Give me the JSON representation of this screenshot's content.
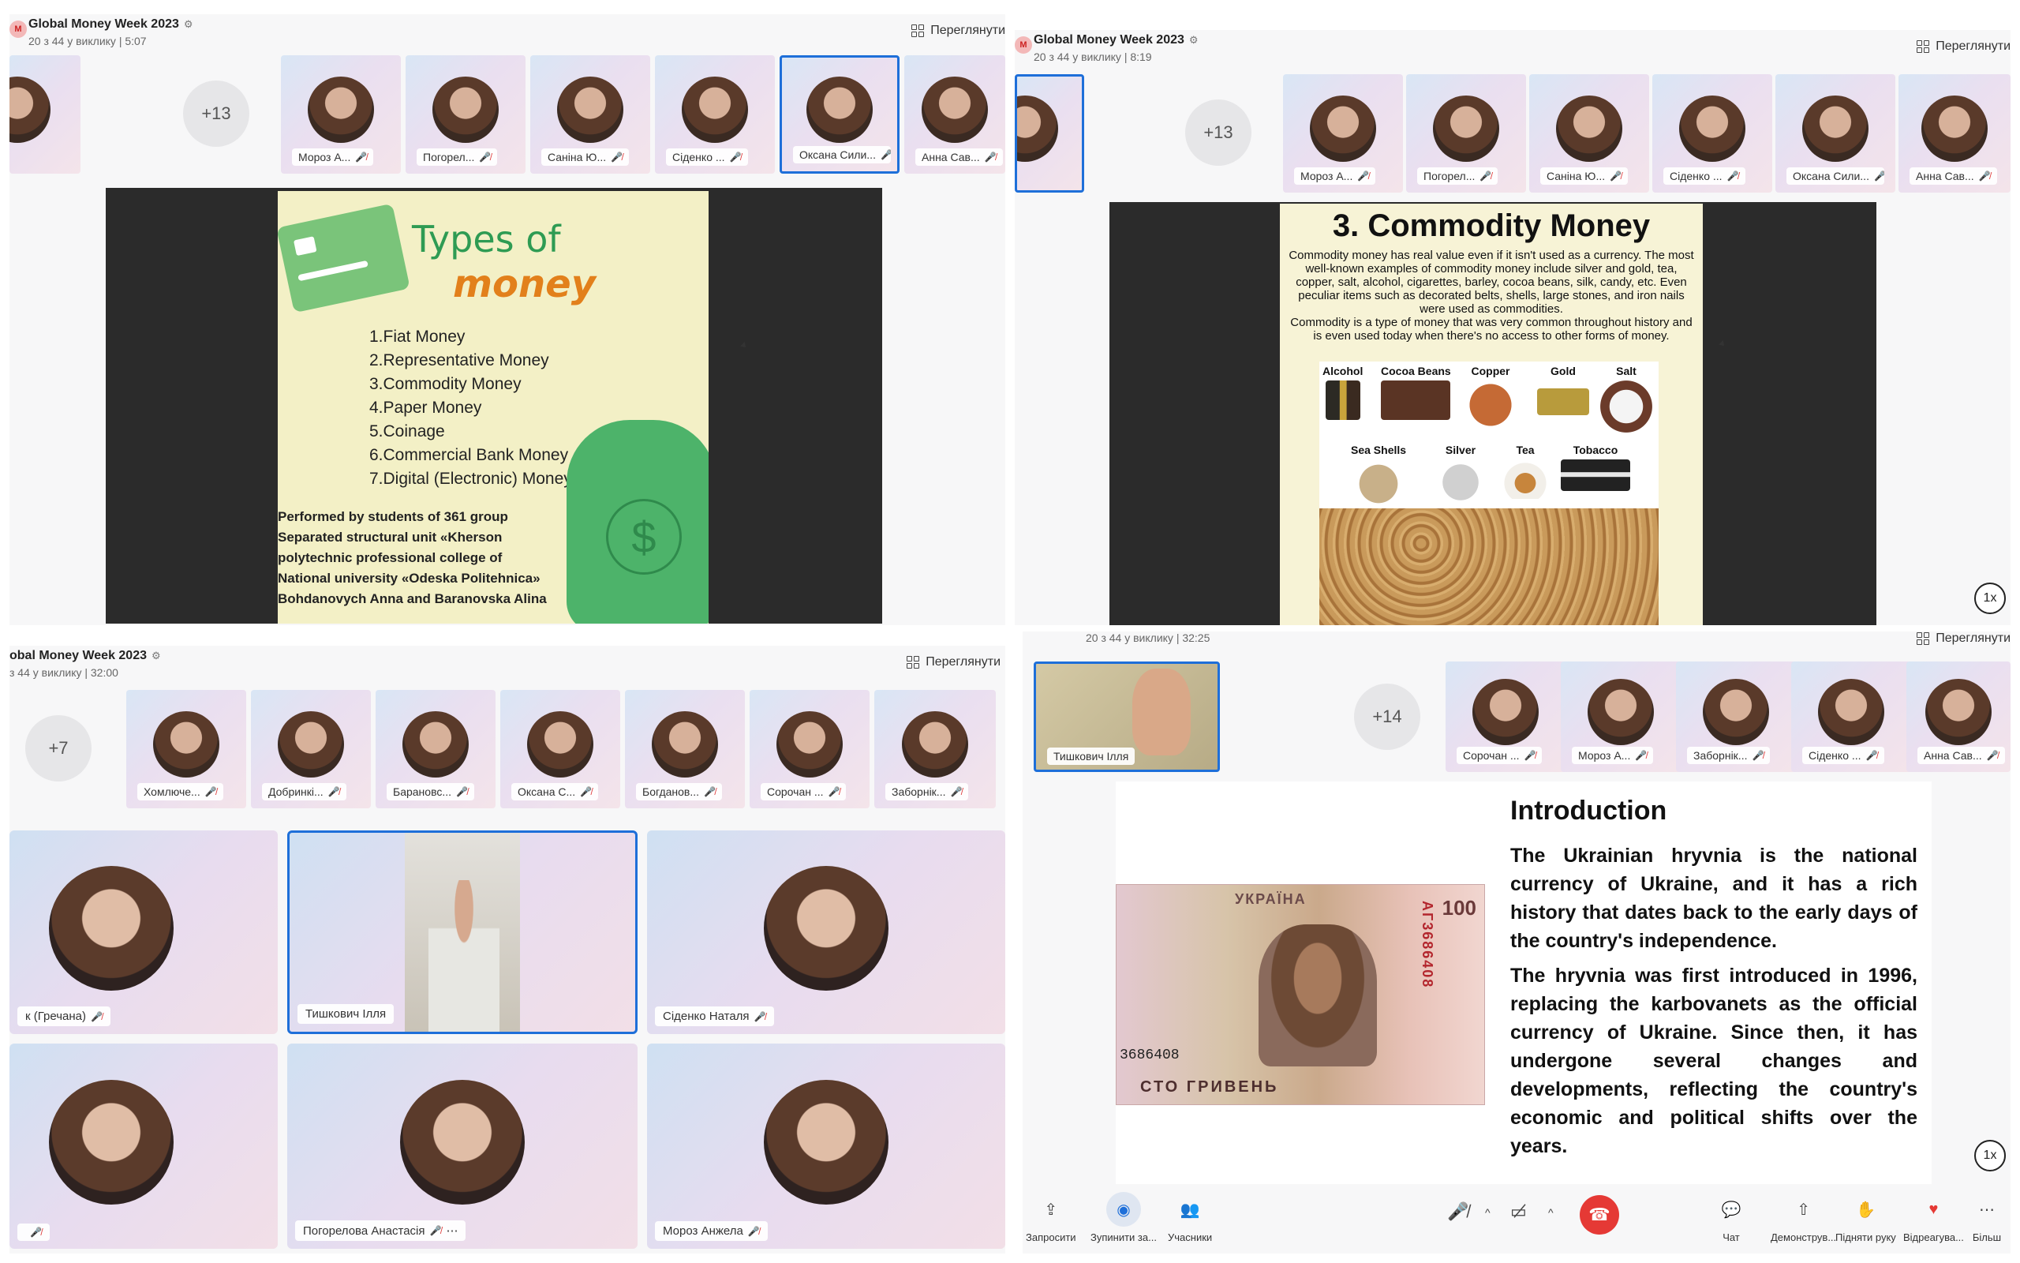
{
  "q1": {
    "title": "Global Money Week 2023",
    "subtitle": "20 з 44 у виклику | 5:07",
    "view_label": "Переглянути",
    "more_count": "+13",
    "participants": [
      "Мороз А...",
      "Погорел...",
      "Саніна Ю...",
      "Сіденко ...",
      "Оксана Сили...",
      "Анна Сав..."
    ],
    "selected_index": 4,
    "slide": {
      "title_word1": "Types of",
      "title_word2": "money",
      "list": [
        "1.Fiat Money",
        "2.Representative Money",
        "3.Commodity Money",
        "4.Paper Money",
        "5.Coinage",
        "6.Commercial Bank Money",
        "7.Digital (Electronic) Money"
      ],
      "credits": [
        "Performed by students of 361 group",
        "Separated structural unit «Kherson",
        "polytechnic professional college of",
        " National  university «Odeska Politehnica»",
        "Bohdanovych Anna and Baranovska Alina"
      ]
    }
  },
  "q2": {
    "title": "Global Money Week 2023",
    "subtitle": "20 з 44 у виклику | 8:19",
    "view_label": "Переглянути",
    "more_count": "+13",
    "participants": [
      "Мороз А...",
      "Погорел...",
      "Саніна Ю...",
      "Сіденко ...",
      "Оксана Сили...",
      "Анна Сав..."
    ],
    "speed": "1x",
    "slide": {
      "heading": "3. Commodity Money",
      "para1": "Commodity money has real value even if it isn't used as a currency. The most well-known examples of commodity money include silver and gold, tea, copper, salt, alcohol, cigarettes, barley, cocoa beans, silk, candy, etc. Even peculiar items such as decorated belts, shells, large stones, and iron nails were used as commodities.",
      "para2": "Commodity is a type of money that was very common throughout history and is even used today when there's no access to other forms of money.",
      "row1": [
        "Alcohol",
        "Cocoa Beans",
        "Copper",
        "Gold",
        "Salt"
      ],
      "row2": [
        "Sea Shells",
        "Silver",
        "Tea",
        "Tobacco"
      ]
    }
  },
  "q3": {
    "title": "obal Money Week 2023",
    "subtitle": "з 44 у виклику | 32:00",
    "view_label": "Переглянути",
    "more_count": "+7",
    "participants": [
      "Хомлюче...",
      "Добринкі...",
      "Барановс...",
      "Оксана С...",
      "Богданов...",
      "Сорочан ...",
      "Заборнік..."
    ],
    "tiles": [
      "к (Гречана)",
      "Тишкович Ілля",
      "Сіденко Наталя",
      "",
      "Погорелова Анастасія",
      "Мороз Анжела"
    ]
  },
  "q4": {
    "subtitle": "20 з 44 у виклику | 32:25",
    "view_label": "Переглянути",
    "speaker_name": "Тишкович Ілля",
    "more_count": "+14",
    "participants": [
      "Сорочан ...",
      "Мороз А...",
      "Заборнік...",
      "Сіденко ...",
      "Анна Сав..."
    ],
    "speed": "1x",
    "slide": {
      "heading": "Introduction",
      "para1": "The Ukrainian hryvnia is the national currency of Ukraine, and it has a rich history that dates back to the early days of the country's independence.",
      "para2": "The hryvnia was first introduced in 1996, replacing the karbovanets as the official currency of Ukraine. Since then, it has undergone several changes and developments, reflecting the country's economic and political shifts over the years.",
      "banknote_top": "УКРАЇНА",
      "banknote_denom": "100",
      "banknote_serial": "3686408",
      "banknote_vserial": "АГ3686408",
      "banknote_bottom": "СТО ГРИВЕНЬ"
    },
    "toolbar": {
      "invite": "Запросити",
      "stop": "Зупинити за...",
      "participants": "Учасники",
      "chat": "Чат",
      "share": "Демонструв...",
      "raise": "Підняти руку",
      "react": "Відреагува...",
      "more": "Більш"
    }
  }
}
